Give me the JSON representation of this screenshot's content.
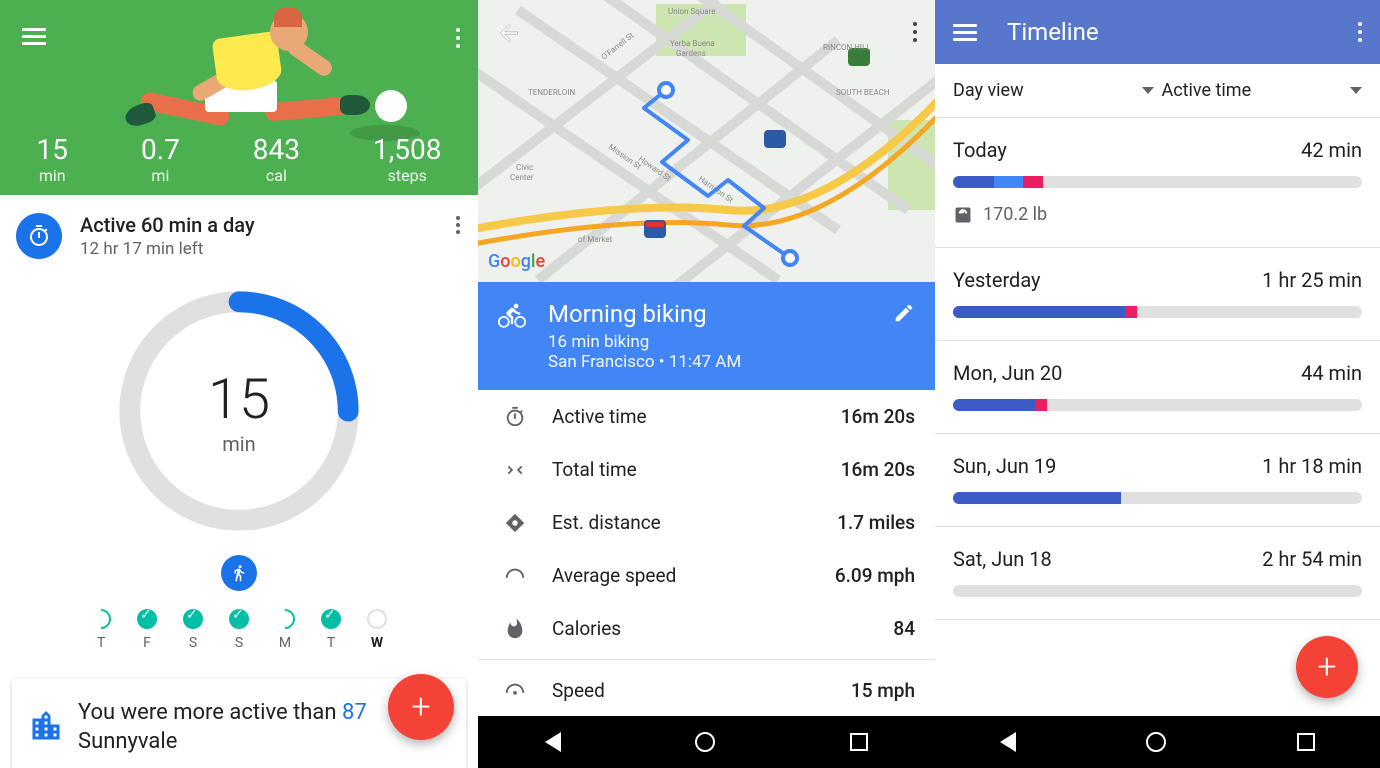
{
  "phone1": {
    "stats": [
      {
        "value": "15",
        "label": "min"
      },
      {
        "value": "0.7",
        "label": "mi"
      },
      {
        "value": "843",
        "label": "cal"
      },
      {
        "value": "1,508",
        "label": "steps"
      }
    ],
    "goal": {
      "title": "Active 60 min a day",
      "subtitle": "12 hr 17 min left"
    },
    "ring": {
      "value": "15",
      "label": "min"
    },
    "week": [
      {
        "label": "T",
        "state": "prog"
      },
      {
        "label": "F",
        "state": "done"
      },
      {
        "label": "S",
        "state": "done"
      },
      {
        "label": "S",
        "state": "done"
      },
      {
        "label": "M",
        "state": "prog"
      },
      {
        "label": "T",
        "state": "done"
      },
      {
        "label": "W",
        "state": "empty",
        "current": true
      }
    ],
    "activity_prefix": "You were more active than ",
    "activity_pct": "87",
    "activity_suffix": "Sunnyvale"
  },
  "phone2": {
    "map_logo": "Google",
    "activity": {
      "title": "Morning biking",
      "subtitle1": "16 min biking",
      "subtitle2": "San Francisco • 11:47 AM"
    },
    "rows": [
      {
        "icon": "timer",
        "label": "Active time",
        "value": "16m 20s"
      },
      {
        "icon": "arrows",
        "label": "Total time",
        "value": "16m 20s"
      },
      {
        "icon": "place",
        "label": "Est. distance",
        "value": "1.7 miles"
      },
      {
        "icon": "gauge",
        "label": "Average speed",
        "value": "6.09 mph"
      },
      {
        "icon": "fire",
        "label": "Calories",
        "value": "84"
      },
      {
        "icon": "speed",
        "label": "Speed",
        "value": "15 mph"
      }
    ]
  },
  "phone3": {
    "title": "Timeline",
    "filter1": "Day view",
    "filter2": "Active time",
    "entries": [
      {
        "label": "Today",
        "duration": "42 min",
        "segments": [
          {
            "c": "#3b5bc7",
            "w": 10
          },
          {
            "c": "#4285f4",
            "w": 7
          },
          {
            "c": "#e91e63",
            "w": 5
          }
        ],
        "weight": "170.2 lb"
      },
      {
        "label": "Yesterday",
        "duration": "1 hr 25 min",
        "segments": [
          {
            "c": "#3b5bc7",
            "w": 42
          },
          {
            "c": "#e91e63",
            "w": 3
          }
        ]
      },
      {
        "label": "Mon, Jun 20",
        "duration": "44 min",
        "segments": [
          {
            "c": "#3b5bc7",
            "w": 20
          },
          {
            "c": "#e91e63",
            "w": 3
          }
        ]
      },
      {
        "label": "Sun, Jun 19",
        "duration": "1 hr 18 min",
        "segments": [
          {
            "c": "#3b5bc7",
            "w": 41
          }
        ]
      },
      {
        "label": "Sat, Jun 18",
        "duration": "2 hr 54 min",
        "segments": []
      }
    ]
  }
}
